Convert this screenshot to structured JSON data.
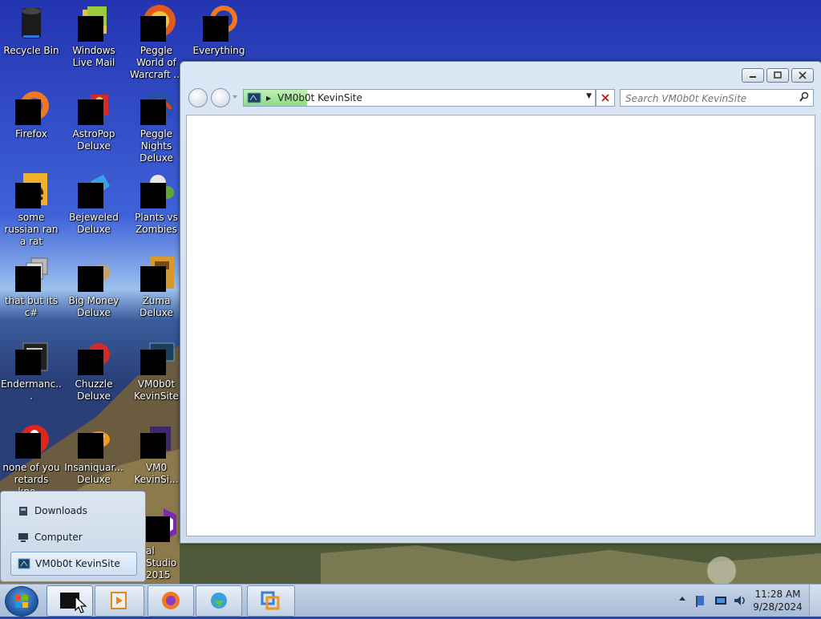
{
  "desktop": {
    "icons": [
      {
        "label": "Recycle Bin"
      },
      {
        "label": "Windows Live Mail"
      },
      {
        "label": "Peggle World of Warcraft ..."
      },
      {
        "label": "Everything"
      },
      {
        "label": "Firefox"
      },
      {
        "label": "AstroPop Deluxe"
      },
      {
        "label": "Peggle Nights Deluxe"
      },
      {
        "label": "some russian ran a rat"
      },
      {
        "label": "Bejeweled Deluxe"
      },
      {
        "label": "Plants vs Zombies"
      },
      {
        "label": "that but its c#"
      },
      {
        "label": "Big Money Deluxe"
      },
      {
        "label": "Zuma Deluxe"
      },
      {
        "label": "Endermanc..."
      },
      {
        "label": "Chuzzle Deluxe"
      },
      {
        "label": "VM0b0t KevinSite"
      },
      {
        "label": "none of you retards kno..."
      },
      {
        "label": "Insaniquar... Deluxe"
      },
      {
        "label": "VM0 KevinSi..."
      },
      {
        "label": "al Studio 2015"
      }
    ]
  },
  "window": {
    "address_text": "VM0b0t KevinSite",
    "search_placeholder": "Search VM0b0t KevinSite",
    "load_progress": 0.18
  },
  "jumplist": {
    "items": [
      {
        "label": "Downloads"
      },
      {
        "label": "Computer"
      },
      {
        "label": "VM0b0t KevinSite"
      }
    ]
  },
  "taskbar": {
    "time": "11:28 AM",
    "date": "9/28/2024"
  },
  "colors": {
    "stop_x": "#c0181a",
    "progress": "#8fdc83"
  }
}
